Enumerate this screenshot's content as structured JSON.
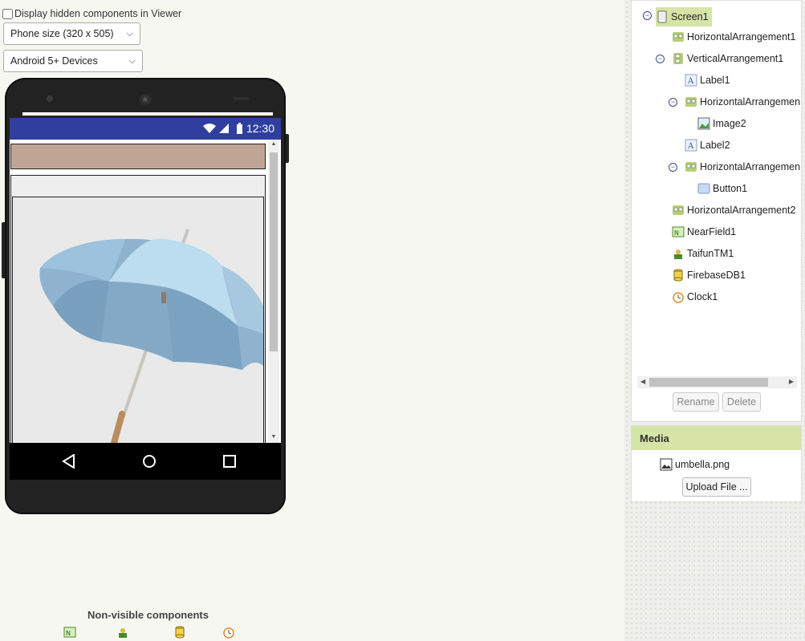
{
  "viewer": {
    "hidden_checkbox_label": "Display hidden components in Viewer",
    "phone_size": "Phone size (320 x 505)",
    "device": "Android 5+ Devices",
    "status_time": "12:30",
    "nonvisible_title": "Non-visible components"
  },
  "tree": {
    "items": [
      {
        "label": "Screen1",
        "icon": "screen-icon"
      },
      {
        "label": "HorizontalArrangement1",
        "icon": "horizontal-arrangement-icon"
      },
      {
        "label": "VerticalArrangement1",
        "icon": "vertical-arrangement-icon"
      },
      {
        "label": "Label1",
        "icon": "label-icon"
      },
      {
        "label": "HorizontalArrangemen",
        "icon": "horizontal-arrangement-icon"
      },
      {
        "label": "Image2",
        "icon": "image-icon"
      },
      {
        "label": "Label2",
        "icon": "label-icon"
      },
      {
        "label": "HorizontalArrangemen",
        "icon": "horizontal-arrangement-icon"
      },
      {
        "label": "Button1",
        "icon": "button-icon"
      },
      {
        "label": "HorizontalArrangement2",
        "icon": "horizontal-arrangement-icon"
      },
      {
        "label": "NearField1",
        "icon": "nearfield-icon"
      },
      {
        "label": "TaifunTM1",
        "icon": "taifun-icon"
      },
      {
        "label": "FirebaseDB1",
        "icon": "database-icon"
      },
      {
        "label": "Clock1",
        "icon": "clock-icon"
      }
    ],
    "rename_label": "Rename",
    "delete_label": "Delete"
  },
  "media": {
    "title": "Media",
    "file": "umbella.png",
    "upload_label": "Upload File ..."
  },
  "colors": {
    "status_bar": "#303f9f",
    "selected": "#d6e4a8",
    "arrangement_fill": "#c0a597"
  }
}
